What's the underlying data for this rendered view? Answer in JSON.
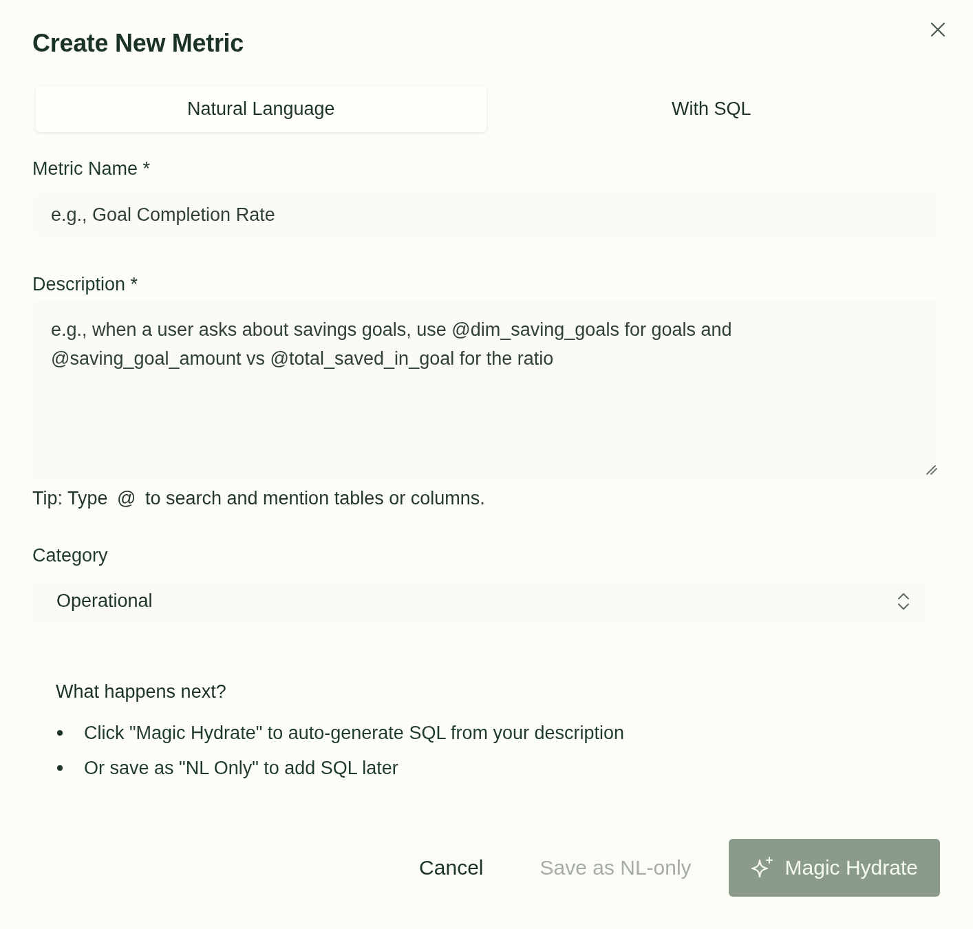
{
  "dialog": {
    "title": "Create New Metric"
  },
  "tabs": [
    {
      "label": "Natural Language",
      "selected": true
    },
    {
      "label": "With SQL",
      "selected": false
    }
  ],
  "fields": [
    {
      "kind": "input",
      "label": "Metric Name *",
      "placeholder": "e.g., Goal Completion Rate"
    },
    {
      "kind": "textarea",
      "label": "Description *",
      "placeholder": "e.g., when a user asks about savings goals, use @dim_saving_goals for goals and @saving_goal_amount vs @total_saved_in_goal for the ratio"
    }
  ],
  "tip": {
    "before": "Tip: Type",
    "mention": "@",
    "after": "to search and mention tables or columns."
  },
  "category": {
    "label": "Category",
    "value": "Operational"
  },
  "next_steps": {
    "heading": "What happens next?",
    "items": [
      "Click \"Magic Hydrate\" to auto-generate SQL from your description",
      "Or save as \"NL Only\" to add SQL later"
    ]
  },
  "buttons": [
    {
      "label": "Cancel",
      "kind": "text",
      "disabled": false
    },
    {
      "label": "Save as NL-only",
      "kind": "text",
      "disabled": true
    },
    {
      "label": "Magic Hydrate",
      "kind": "primary",
      "disabled": true
    }
  ]
}
